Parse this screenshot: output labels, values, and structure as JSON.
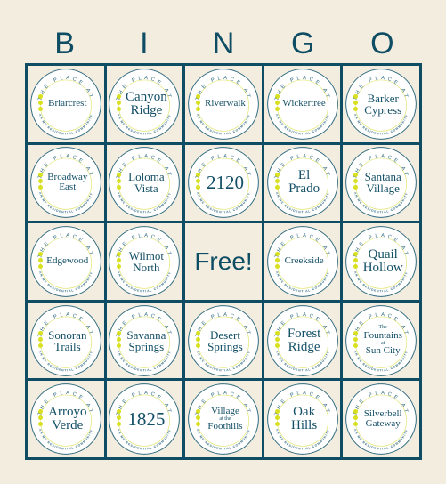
{
  "header": {
    "letters": [
      "B",
      "I",
      "N",
      "G",
      "O"
    ]
  },
  "logo": {
    "top_arc": "THE PLACE AT",
    "bottom_arc": "AN MC RESIDENTIAL COMMUNITY",
    "accent_color": "#d8e020",
    "brand_color": "#134f66"
  },
  "free_label": "Free!",
  "cells": [
    {
      "lines": [
        "Briarcrest"
      ],
      "size": "s"
    },
    {
      "lines": [
        "Canyon",
        "Ridge"
      ],
      "size": "l"
    },
    {
      "lines": [
        "Riverwalk"
      ],
      "size": "s"
    },
    {
      "lines": [
        "Wickertree"
      ],
      "size": "s"
    },
    {
      "lines": [
        "Barker",
        "Cypress"
      ],
      "size": "m"
    },
    {
      "lines": [
        "Broadway",
        "East"
      ],
      "size": "s"
    },
    {
      "lines": [
        "Loloma",
        "Vista"
      ],
      "size": "m"
    },
    {
      "lines": [
        "2120"
      ],
      "size": "xl"
    },
    {
      "lines": [
        "El",
        "Prado"
      ],
      "size": "l"
    },
    {
      "lines": [
        "Santana",
        "Village"
      ],
      "size": "m"
    },
    {
      "lines": [
        "Edgewood"
      ],
      "size": "s"
    },
    {
      "lines": [
        "Wilmot",
        "North"
      ],
      "size": "m"
    },
    {
      "free": true
    },
    {
      "lines": [
        "Creekside"
      ],
      "size": "s"
    },
    {
      "lines": [
        "Quail",
        "Hollow"
      ],
      "size": "l"
    },
    {
      "lines": [
        "Sonoran",
        "Trails"
      ],
      "size": "m"
    },
    {
      "lines": [
        "Savanna",
        "Springs"
      ],
      "size": "m"
    },
    {
      "lines": [
        "Desert",
        "Springs"
      ],
      "size": "m"
    },
    {
      "lines": [
        "Forest",
        "Ridge"
      ],
      "size": "l"
    },
    {
      "lines": [
        "The",
        "Fountains",
        "at",
        "Sun City"
      ],
      "size": "fountains"
    },
    {
      "lines": [
        "Arroyo",
        "Verde"
      ],
      "size": "l"
    },
    {
      "lines": [
        "1825"
      ],
      "size": "xl"
    },
    {
      "lines": [
        "Village",
        "at the",
        "Foothills"
      ],
      "size": "village"
    },
    {
      "lines": [
        "Oak",
        "Hills"
      ],
      "size": "l"
    },
    {
      "lines": [
        "Silverbell",
        "Gateway"
      ],
      "size": "s"
    }
  ]
}
